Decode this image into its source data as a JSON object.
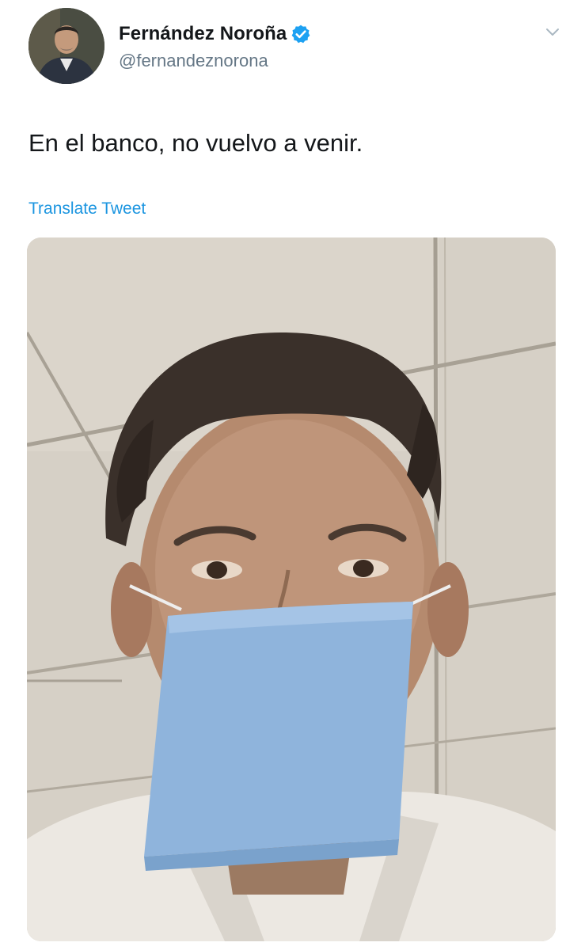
{
  "tweet": {
    "display_name": "Fernández Noroña",
    "handle": "@fernandeznorona",
    "text": "En el banco, no vuelvo a venir.",
    "translate_label": "Translate Tweet",
    "verified": true
  },
  "icons": {
    "verified": "verified-badge-icon",
    "caret": "chevron-down-icon"
  },
  "colors": {
    "name": "#14171a",
    "handle": "#657786",
    "link": "#1b95e0",
    "verified": "#1da1f2",
    "mask": "#8fb4dc"
  }
}
